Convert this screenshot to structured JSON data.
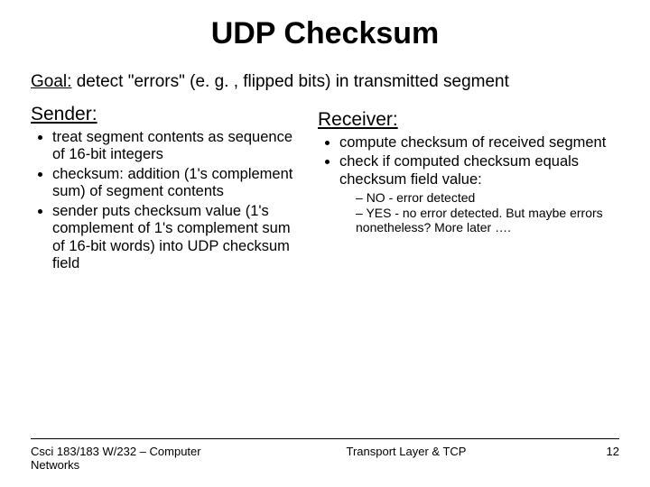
{
  "title": "UDP Checksum",
  "goal": {
    "label": "Goal:",
    "text": " detect \"errors\" (e. g. , flipped bits) in transmitted segment"
  },
  "sender": {
    "heading": "Sender:",
    "items": [
      "treat segment contents as sequence of 16-bit integers",
      "checksum: addition (1's complement sum) of segment contents",
      "sender puts checksum value (1's complement of 1's complement sum of 16-bit words) into UDP checksum field"
    ]
  },
  "receiver": {
    "heading": "Receiver:",
    "items": [
      "compute checksum of received segment",
      "check if computed checksum equals checksum field value:"
    ],
    "sub": [
      "NO - error detected",
      "YES - no error detected. But maybe errors nonetheless? More later …."
    ]
  },
  "footer": {
    "left": "Csci 183/183 W/232 – Computer Networks",
    "center": "Transport Layer &  TCP",
    "right": "12"
  }
}
